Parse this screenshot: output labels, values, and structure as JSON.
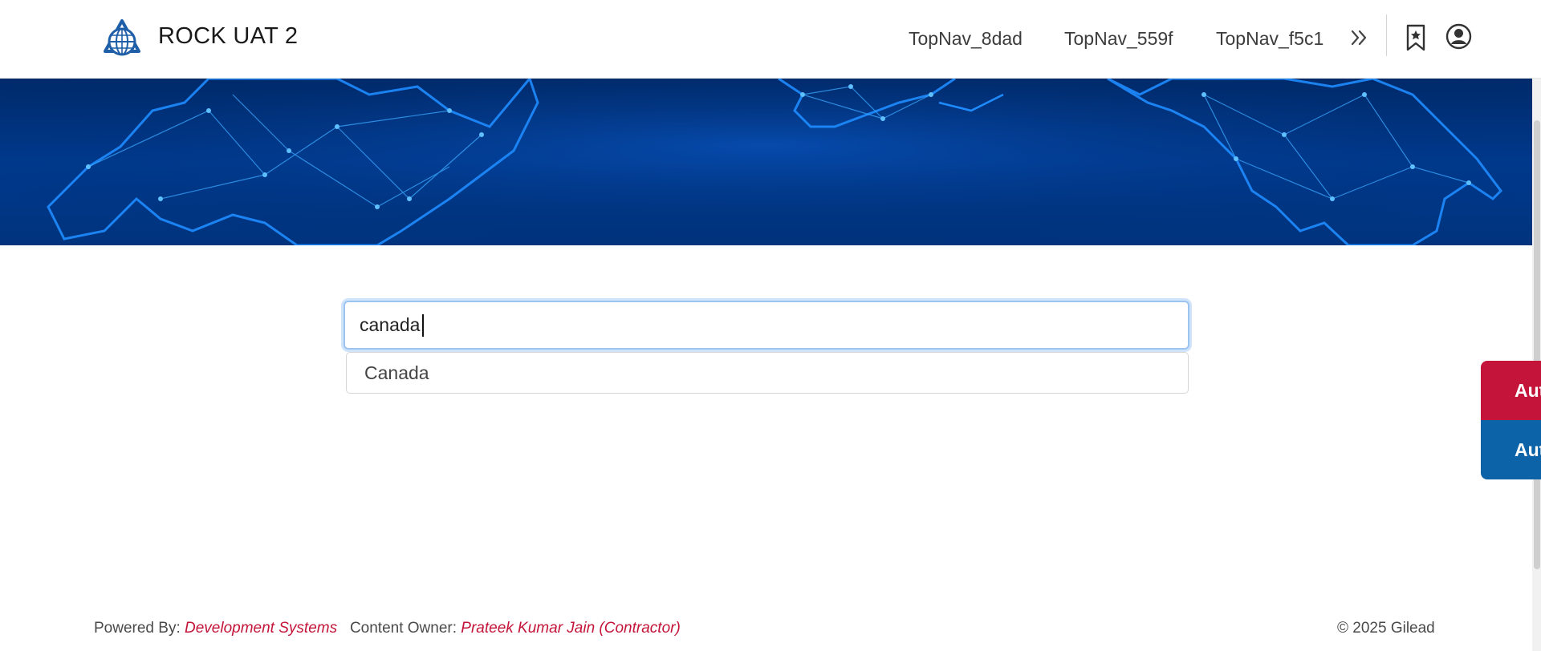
{
  "header": {
    "app_title": "ROCK UAT 2",
    "logo_icon": "globe-logo-icon",
    "nav_links": [
      "TopNav_8dad",
      "TopNav_559f",
      "TopNav_f5c1"
    ],
    "more_icon": "double-chevron-right-icon",
    "bookmark_icon": "bookmark-star-icon",
    "user_icon": "user-circle-icon"
  },
  "search": {
    "value": "canada",
    "suggestions": [
      "Canada"
    ]
  },
  "side_tabs": [
    "Aut",
    "Aut"
  ],
  "footer": {
    "powered_by_label": "Powered By:",
    "powered_by_link": "Development Systems",
    "content_owner_label": "Content Owner:",
    "content_owner_link": "Prateek Kumar Jain (Contractor)",
    "copyright": "© 2025 Gilead"
  },
  "colors": {
    "brand_red": "#c41439",
    "brand_blue": "#0c63a8",
    "banner_dark": "#002a6a",
    "focus_ring": "#9cc4f0"
  }
}
